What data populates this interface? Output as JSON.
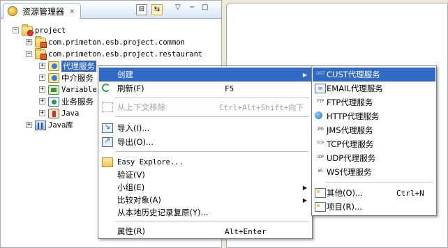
{
  "view": {
    "title": "资源管理器",
    "close_glyph": "×",
    "toolbar": {
      "collapse_glyph": "⊟",
      "sync_glyph": "⇆",
      "menu_glyph": "▽",
      "minimize_glyph": "−",
      "maximize_glyph": "□"
    }
  },
  "tree": [
    {
      "label": "project",
      "expander": "−",
      "icon": "folder-project-icon"
    },
    {
      "label": "com.primeton.esb.project.common",
      "expander": "+",
      "icon": "package-icon"
    },
    {
      "label": "com.primeton.esb.project.restaurant",
      "expander": "−",
      "icon": "package-icon"
    },
    {
      "label": "代理服务",
      "expander": "+",
      "icon": "proxy-service-icon",
      "selected": true
    },
    {
      "label": "中介服务",
      "expander": "+",
      "icon": "mediation-service-icon"
    },
    {
      "label": "Variable",
      "expander": "+",
      "icon": "variable-icon"
    },
    {
      "label": "业务服务",
      "expander": "+",
      "icon": "business-service-icon"
    },
    {
      "label": "Java",
      "expander": "+",
      "icon": "java-icon"
    },
    {
      "label": "Java库",
      "expander": "+",
      "icon": "library-icon"
    }
  ],
  "context_menu": {
    "items": [
      {
        "label": "创建",
        "has_submenu": true,
        "highlighted": true
      },
      {
        "label": "刷新(F)",
        "accelerator": "F5",
        "icon": "refresh-icon"
      },
      {
        "label": "从上下文移除",
        "accelerator": "Ctrl+Alt+Shift+向下",
        "disabled": true
      },
      {
        "label": "导入(I)...",
        "icon": "import-icon"
      },
      {
        "label": "导出(O)...",
        "icon": "export-icon"
      },
      {
        "label": "Easy Explore...",
        "icon": "easy-explore-icon"
      },
      {
        "label": "验证(V)"
      },
      {
        "label": "小组(E)",
        "has_submenu": true
      },
      {
        "label": "比较对象(A)",
        "has_submenu": true
      },
      {
        "label": "从本地历史记录复原(Y)..."
      },
      {
        "label": "属性(R)",
        "accelerator": "Alt+Enter"
      }
    ],
    "submenu_arrow": "▶"
  },
  "create_submenu": {
    "items": [
      {
        "label": "CUST代理服务",
        "icon_text": "CUST",
        "highlighted": true
      },
      {
        "label": "EMAIL代理服务",
        "icon_text": "✉"
      },
      {
        "label": "FTP代理服务",
        "icon_text": "FTP"
      },
      {
        "label": "HTTP代理服务",
        "icon_text": ""
      },
      {
        "label": "JMS代理服务",
        "icon_text": "JMS"
      },
      {
        "label": "TCP代理服务",
        "icon_text": "TCP"
      },
      {
        "label": "UDP代理服务",
        "icon_text": "UDP"
      },
      {
        "label": "WS代理服务",
        "icon_text": "WS"
      },
      {
        "label": "其他(O)...",
        "accelerator": "Ctrl+N"
      },
      {
        "label": "项目(R)..."
      }
    ]
  }
}
